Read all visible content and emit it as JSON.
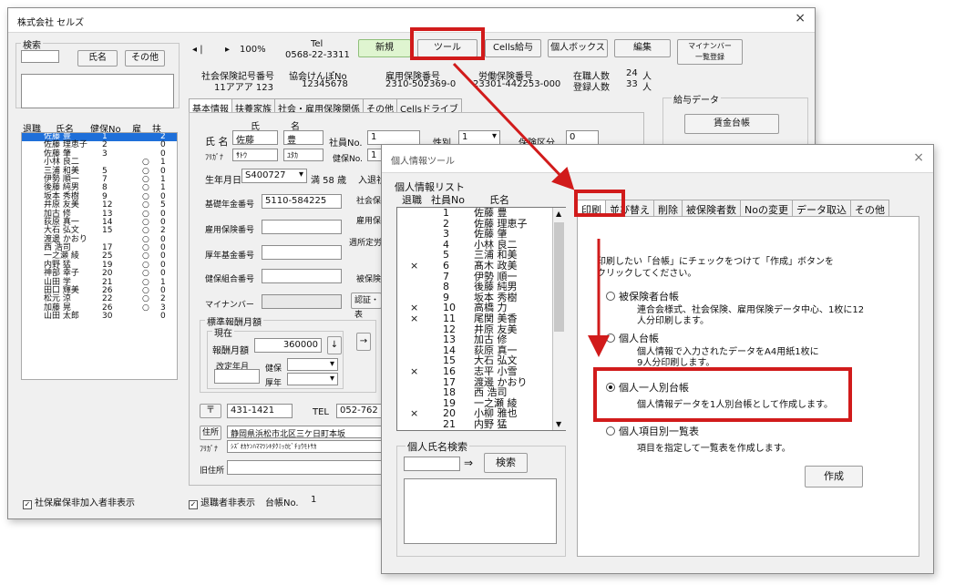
{
  "main": {
    "title": "株式会社 セルズ",
    "close": "×",
    "search": {
      "label": "検索",
      "name_btn": "氏名",
      "other_btn": "その他"
    },
    "list_headers": [
      "退職",
      "氏名",
      "健保No",
      "雇",
      "扶"
    ],
    "employees": [
      {
        "name": "佐藤 豊",
        "no": "1",
        "ko": "",
        "fu": "2"
      },
      {
        "name": "佐藤 理恵子",
        "no": "2",
        "ko": "",
        "fu": "0"
      },
      {
        "name": "佐藤 肇",
        "no": "3",
        "ko": "",
        "fu": "0"
      },
      {
        "name": "小林 良二",
        "no": "",
        "ko": "○",
        "fu": "1"
      },
      {
        "name": "三浦 和美",
        "no": "5",
        "ko": "○",
        "fu": "0"
      },
      {
        "name": "伊勢 順一",
        "no": "7",
        "ko": "○",
        "fu": "1"
      },
      {
        "name": "後藤 純男",
        "no": "8",
        "ko": "○",
        "fu": "1"
      },
      {
        "name": "坂本 秀樹",
        "no": "9",
        "ko": "○",
        "fu": "0"
      },
      {
        "name": "井原 友美",
        "no": "12",
        "ko": "○",
        "fu": "5"
      },
      {
        "name": "加古 修",
        "no": "13",
        "ko": "○",
        "fu": "0"
      },
      {
        "name": "荻原 真一",
        "no": "14",
        "ko": "○",
        "fu": "0"
      },
      {
        "name": "大石 弘文",
        "no": "15",
        "ko": "○",
        "fu": "2"
      },
      {
        "name": "渡邊 かおり",
        "no": "",
        "ko": "○",
        "fu": "0"
      },
      {
        "name": "西 浩司",
        "no": "17",
        "ko": "○",
        "fu": "0"
      },
      {
        "name": "一之瀬 綾",
        "no": "25",
        "ko": "○",
        "fu": "0"
      },
      {
        "name": "内野 猛",
        "no": "19",
        "ko": "○",
        "fu": "0"
      },
      {
        "name": "神部 幸子",
        "no": "20",
        "ko": "○",
        "fu": "0"
      },
      {
        "name": "山田 学",
        "no": "21",
        "ko": "○",
        "fu": "1"
      },
      {
        "name": "田口 輝美",
        "no": "26",
        "ko": "○",
        "fu": "0"
      },
      {
        "name": "松元 涼",
        "no": "22",
        "ko": "○",
        "fu": "2"
      },
      {
        "name": "加藤 晃",
        "no": "26",
        "ko": "○",
        "fu": "3"
      },
      {
        "name": "山田 太郎",
        "no": "30",
        "ko": "",
        "fu": "0"
      }
    ],
    "nav": {
      "prev": "◂",
      "bar": "|",
      "next": "▸",
      "zoom": "100%"
    },
    "tel_label": "Tel",
    "tel_value": "0568-22-3311",
    "buttons": {
      "new": "新規",
      "tool": "ツール",
      "cells_pay": "Cells給与",
      "personal_box": "個人ボックス",
      "edit": "編集",
      "mynumber": "マイナンバー\n一覧登録"
    },
    "info": {
      "social_no_label": "社会保険記号番号",
      "social_no": "11アアア 123",
      "kenpo_label": "協会けんぽNo",
      "kenpo": "12345678",
      "koyo_label": "雇用保険番号",
      "koyo": "2310-502369-0",
      "rodo_label": "労働保険番号",
      "rodo": "23301-442253-000",
      "zaishoku_label": "在職人数",
      "zaishoku": "24",
      "toroku_label": "登録人数",
      "toroku": "33",
      "unit": "人"
    },
    "tabs": [
      "基本情報",
      "扶養家族",
      "社会・雇用保険関係",
      "その他",
      "Cellsドライブ"
    ],
    "form": {
      "shi_label": "氏",
      "mei_label": "名",
      "name_label": "氏 名",
      "sei": "佐藤",
      "mei": "豊",
      "furigana_label": "ﾌﾘｶﾞﾅ",
      "sei_kana": "ｻﾄｳ",
      "mei_kana": "ﾕﾀｶ",
      "emp_no_label": "社員No.",
      "emp_no": "1",
      "kenpo_no_label": "健保No.",
      "kenpo_no": "1",
      "sex_label": "性別",
      "sex": "1",
      "insurance_label": "保険区分",
      "insurance": "0",
      "birth_label": "生年月日",
      "birth": "S400727",
      "age": "満 58 歳",
      "nyusha": "入退社",
      "kiso_label": "基礎年金番号",
      "kiso": "5110-584225",
      "shakai_label": "社会保",
      "koyoho_label": "雇用保",
      "shuusho_label": "週所定労",
      "koyo_label": "雇用保険番号",
      "kosei_label": "厚年基金番号",
      "kenpo_kumiai_label": "健保組合番号",
      "hihoken_label": "被保険",
      "mynumber_label": "マイナンバー",
      "ninsho": "認証・表",
      "hyojun_label": "標準報酬月額",
      "genzai_label": "現在",
      "hoshu_label": "報酬月額",
      "hoshu": "360000",
      "kaitei_label": "改定年月",
      "kenpo_s": "健保",
      "kosei_s": "厚年",
      "yubin_mark": "〒",
      "zip": "431-1421",
      "tel_label": "TEL",
      "tel": "052-762",
      "addr_label": "住所",
      "addr": "静岡県浜松市北区三ケ日町本坂",
      "addr_kana_label": "ﾌﾘｶﾞﾅ",
      "addr_kana": "ｼｽﾞｵｶｹﾝﾊﾏﾏﾂｼｷﾀｸﾐｯｶﾋﾞﾁｮｳﾓﾄｻｶ",
      "old_addr_label": "旧住所"
    },
    "kyuyo": {
      "label": "給与データ",
      "btn": "賃金台帳"
    },
    "footer": {
      "shaho": "社保雇保非加入者非表示",
      "taishoku": "退職者非表示",
      "daicho_label": "台帳No.",
      "daicho": "1"
    }
  },
  "dialog": {
    "title": "個人情報ツール",
    "close": "×",
    "list_label": "個人情報リスト",
    "list_headers": [
      "退職",
      "社員No",
      "氏名"
    ],
    "rows": [
      {
        "ret": "",
        "no": "1",
        "name": "佐藤 豊"
      },
      {
        "ret": "",
        "no": "2",
        "name": "佐藤 理恵子"
      },
      {
        "ret": "",
        "no": "3",
        "name": "佐藤 肇"
      },
      {
        "ret": "",
        "no": "4",
        "name": "小林 良二"
      },
      {
        "ret": "",
        "no": "5",
        "name": "三浦 和美"
      },
      {
        "ret": "×",
        "no": "6",
        "name": "髙木 政美"
      },
      {
        "ret": "",
        "no": "7",
        "name": "伊勢 順一"
      },
      {
        "ret": "",
        "no": "8",
        "name": "後藤 純男"
      },
      {
        "ret": "",
        "no": "9",
        "name": "坂本 秀樹"
      },
      {
        "ret": "×",
        "no": "10",
        "name": "高橋 力"
      },
      {
        "ret": "×",
        "no": "11",
        "name": "尾関 美香"
      },
      {
        "ret": "",
        "no": "12",
        "name": "井原 友美"
      },
      {
        "ret": "",
        "no": "13",
        "name": "加古 修"
      },
      {
        "ret": "",
        "no": "14",
        "name": "荻原 真一"
      },
      {
        "ret": "",
        "no": "15",
        "name": "大石 弘文"
      },
      {
        "ret": "×",
        "no": "16",
        "name": "志平 小雪"
      },
      {
        "ret": "",
        "no": "17",
        "name": "渡邊 かおり"
      },
      {
        "ret": "",
        "no": "18",
        "name": "西 浩司"
      },
      {
        "ret": "",
        "no": "19",
        "name": "一之瀬 綾"
      },
      {
        "ret": "×",
        "no": "20",
        "name": "小柳 雅也"
      },
      {
        "ret": "",
        "no": "21",
        "name": "内野 猛"
      }
    ],
    "search_label": "個人氏名検索",
    "search_arrow": "⇒",
    "search_btn": "検索",
    "tabs": [
      "印刷",
      "並び替え",
      "削除",
      "被保険者数",
      "Noの変更",
      "データ取込",
      "その他"
    ],
    "instruction": "印刷したい「台帳」にチェックをつけて「作成」ボタンをクリックしてください。",
    "options": [
      {
        "title": "被保険者台帳",
        "desc": "連合会様式、社会保険、雇用保険データ中心、1枚に12人分印刷します。"
      },
      {
        "title": "個人台帳",
        "desc": "個人情報で入力されたデータをA4用紙1枚に9人分印刷します。"
      },
      {
        "title": "個人一人別台帳",
        "desc": "個人情報データを1人別台帳として作成します。"
      },
      {
        "title": "個人項目別一覧表",
        "desc": "項目を指定して一覧表を作成します。"
      }
    ],
    "create_btn": "作成"
  },
  "colors": {
    "annotation_red": "#d11b1b",
    "selection": "#1e6fd9",
    "new_button_bg": "#dff5d0"
  }
}
